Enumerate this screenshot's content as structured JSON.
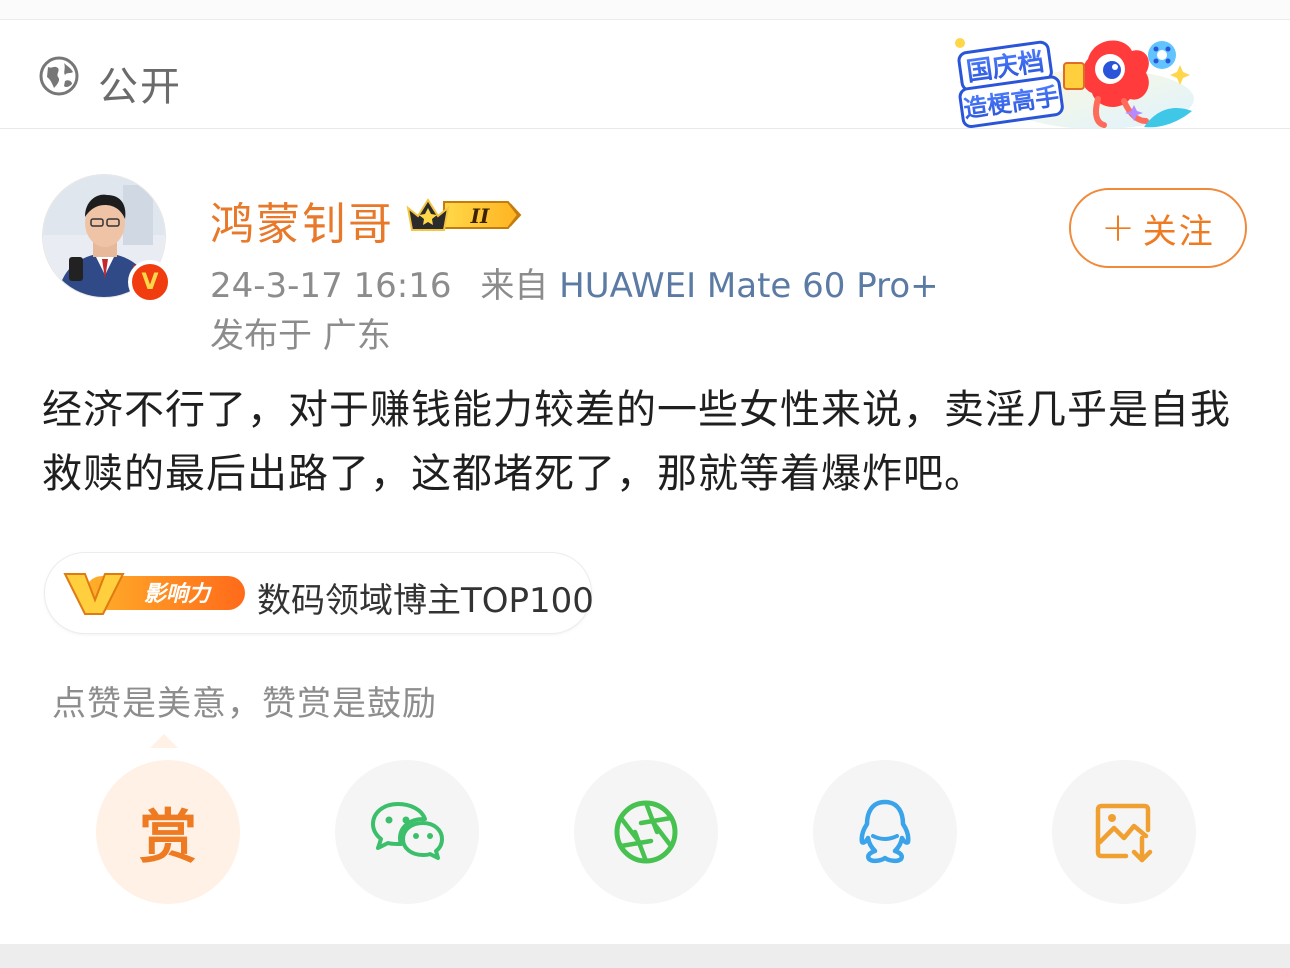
{
  "visibility": {
    "label": "公开",
    "icon": "globe-icon"
  },
  "event_badge": {
    "line1": "国庆档",
    "line2": "造梗高手"
  },
  "author": {
    "name": "鸿蒙钊哥",
    "level_badge": "II",
    "time": "24-3-17 16:16",
    "from_label": "来自",
    "device": "HUAWEI Mate 60 Pro+",
    "location": "发布于 广东",
    "verified_mark": "V"
  },
  "follow": {
    "label": "关注"
  },
  "post": {
    "text": "经济不行了，对于赚钱能力较差的一些女性来说，卖淫几乎是自我救赎的最后出路了，这都堵死了，那就等着爆炸吧。"
  },
  "influence": {
    "tag_v": "V",
    "tag_label": "影响力",
    "text": "数码领域博主TOP100"
  },
  "reward_hint": "点赞是美意，赞赏是鼓励",
  "share": {
    "reward_label": "赏",
    "items": [
      "reward-icon",
      "wechat-icon",
      "moments-icon",
      "qq-icon",
      "save-image-icon"
    ]
  },
  "colors": {
    "accent": "#ee7b22",
    "device_link": "#5b7ba4",
    "wechat": "#3bbf6b",
    "moments": "#47c14f",
    "qq": "#3aa3ea",
    "save": "#f0a030"
  }
}
